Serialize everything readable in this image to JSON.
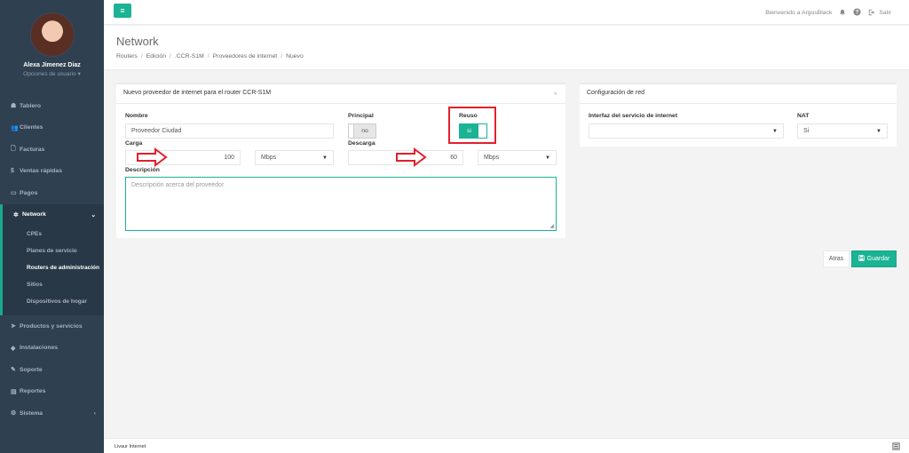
{
  "user": {
    "name": "Alexa Jimenez Diaz",
    "options": "Opciones de usuario ▾"
  },
  "sidebar": {
    "items": [
      {
        "icon": "dashboard-icon",
        "glyph": "☗",
        "label": "Tablero"
      },
      {
        "icon": "users-icon",
        "glyph": "👥",
        "label": "Clientes"
      },
      {
        "icon": "file-icon",
        "glyph": "🗋",
        "label": "Facturas"
      },
      {
        "icon": "dollar-icon",
        "glyph": "$",
        "label": "Ventas rápidas"
      },
      {
        "icon": "money-icon",
        "glyph": "▭",
        "label": "Pagos"
      }
    ],
    "network": {
      "glyph": "✲",
      "label": "Network",
      "chevron": "⌄"
    },
    "subitems": [
      "CPEs",
      "Planes de servicio",
      "Routers de administración",
      "Sitios",
      "Dispositivos de hogar"
    ],
    "items_after": [
      {
        "icon": "tag-icon",
        "glyph": "➤",
        "label": "Productos y servicios"
      },
      {
        "icon": "install-icon",
        "glyph": "◆",
        "label": "Instalaciones"
      },
      {
        "icon": "wrench-icon",
        "glyph": "✎",
        "label": "Soporte"
      },
      {
        "icon": "book-icon",
        "glyph": "▤",
        "label": "Reportes"
      },
      {
        "icon": "cogs-icon",
        "glyph": "⚙",
        "label": "Sistema",
        "chevron": "‹"
      }
    ]
  },
  "topbar": {
    "menu_glyph": "≡",
    "welcome": "Bienvenido a ArgusBlack",
    "logout": "Salir"
  },
  "page": {
    "title": "Network",
    "breadcrumb": [
      "Routers",
      "Edición",
      ".CCR-S1M",
      "Proveedores de internet",
      "Nuevo"
    ]
  },
  "form": {
    "panel_title": "Nuevo proveedor de internet para el router CCR-S1M",
    "close": "×",
    "nombre_label": "Nombre",
    "nombre_value": "Proveedor Ciudad",
    "principal_label": "Principal",
    "principal_value": "no",
    "reuso_label": "Reuso",
    "reuso_value": "si",
    "carga_label": "Carga",
    "carga_value": "100",
    "carga_unit": "Mbps",
    "descarga_label": "Descarga",
    "descarga_value": "60",
    "descarga_unit": "Mbps",
    "descripcion_label": "Descripción",
    "descripcion_placeholder": "Descripción acerca del proveedor"
  },
  "network_config": {
    "panel_title": "Configuración de red",
    "interfaz_label": "Interfaz del servicio de internet",
    "interfaz_value": "",
    "nat_label": "NAT",
    "nat_value": "Si"
  },
  "actions": {
    "back": "Atras",
    "save": "Guardar"
  },
  "footer": {
    "text": "Livaur Internet"
  },
  "colors": {
    "accent": "#1ab394",
    "sidebar": "#2f4050",
    "highlight": "#e2202c"
  }
}
